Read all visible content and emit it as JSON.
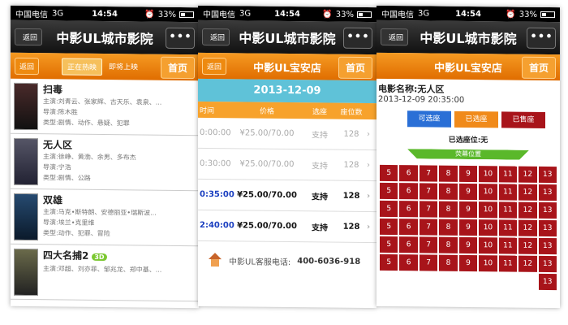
{
  "status": {
    "carrier": "中国电信",
    "network": "3G",
    "time": "14:54",
    "battery": "33%"
  },
  "screen1": {
    "back_label": "返回",
    "title": "中影UL城市影院",
    "more_label": "•••",
    "sub_back_label": "返回",
    "tabs": [
      "正在热映",
      "即将上映"
    ],
    "home_label": "首页",
    "movies": [
      {
        "name": "扫毒",
        "cast": "主演:刘青云、张家辉、古天乐、袁泉、...",
        "director": "导演:陈木胜",
        "genre": "类型:剧情、动作、悬疑、犯罪",
        "badge": ""
      },
      {
        "name": "无人区",
        "cast": "主演:徐峥、黄渤、余男、多布杰",
        "director": "导演:宁浩",
        "genre": "类型:剧情、公路",
        "badge": ""
      },
      {
        "name": "双雄",
        "cast": "主演:马克•斯特朗、安德丽亚•瑞斯波...",
        "director": "导演:埃兰•克里维",
        "genre": "类型:动作、犯罪、冒险",
        "badge": ""
      },
      {
        "name": "四大名捕2",
        "cast": "主演:邓超、刘亦菲、邹兆龙、郑中基、...",
        "director": "",
        "genre": "",
        "badge": "3D"
      }
    ]
  },
  "screen2": {
    "back_label": "返回",
    "title": "中影UL城市影院",
    "more_label": "•••",
    "sub_back_label": "返回",
    "cinema": "中影UL宝安店",
    "home_label": "首页",
    "date": "2013-12-09",
    "headers": [
      "时间",
      "价格",
      "选座",
      "座位数"
    ],
    "rows": [
      {
        "time": "0:00:00",
        "price": "¥25.00/70.00",
        "seat": "支持",
        "count": "128",
        "state": "dim"
      },
      {
        "time": "0:30:00",
        "price": "¥25.00/70.00",
        "seat": "支持",
        "count": "128",
        "state": "dim"
      },
      {
        "time": "0:35:00",
        "price": "¥25.00/70.00",
        "seat": "支持",
        "count": "128",
        "state": "on"
      },
      {
        "time": "2:40:00",
        "price": "¥25.00/70.00",
        "seat": "支持",
        "count": "128",
        "state": "on"
      }
    ],
    "hotline_label": "中影UL客服电话:",
    "hotline": "400-6036-918"
  },
  "screen3": {
    "back_label": "返回",
    "title": "中影UL城市影院",
    "more_label": "•••",
    "cinema": "中影UL宝安店",
    "home_label": "首页",
    "movie_label": "电影名称:无人区",
    "datetime": "2013-12-09 20:35:00",
    "legend": [
      "可选座",
      "已选座",
      "已售座"
    ],
    "selected_label": "已选座位:无",
    "screen_label": "荧幕位置",
    "seat_rows": [
      [
        "5",
        "6",
        "7",
        "8",
        "9",
        "10",
        "11",
        "12",
        "13"
      ],
      [
        "5",
        "6",
        "7",
        "8",
        "9",
        "10",
        "11",
        "12",
        "13"
      ],
      [
        "5",
        "6",
        "7",
        "8",
        "9",
        "10",
        "11",
        "12",
        "13"
      ],
      [
        "5",
        "6",
        "7",
        "8",
        "9",
        "10",
        "11",
        "12",
        "13"
      ],
      [
        "5",
        "6",
        "7",
        "8",
        "9",
        "10",
        "11",
        "12",
        "13"
      ],
      [
        "5",
        "6",
        "7",
        "8",
        "9",
        "10",
        "11",
        "12",
        "13"
      ],
      [
        "",
        "",
        "",
        "",
        "",
        "",
        "",
        "",
        "13"
      ]
    ]
  }
}
